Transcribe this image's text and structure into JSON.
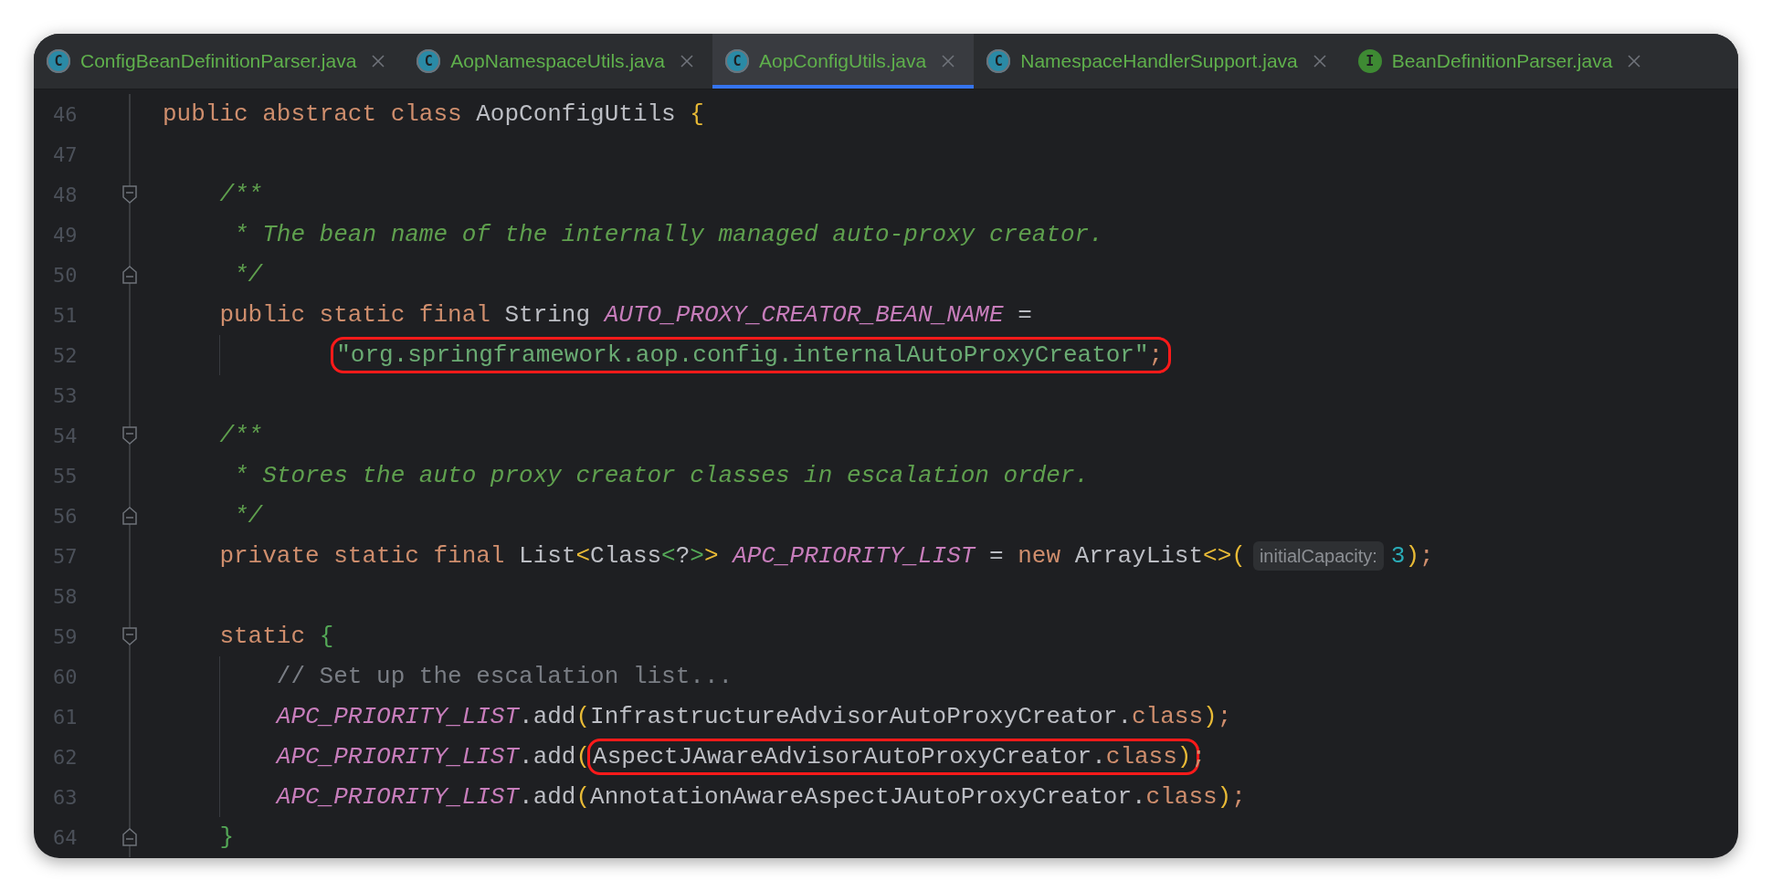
{
  "tabs": [
    {
      "label": "ConfigBeanDefinitionParser.java",
      "icon": {
        "kind": "class",
        "letter": "C"
      },
      "selected": false
    },
    {
      "label": "AopNamespaceUtils.java",
      "icon": {
        "kind": "class",
        "letter": "C"
      },
      "selected": false
    },
    {
      "label": "AopConfigUtils.java",
      "icon": {
        "kind": "class",
        "letter": "C"
      },
      "selected": true
    },
    {
      "label": "NamespaceHandlerSupport.java",
      "icon": {
        "kind": "class",
        "letter": "C"
      },
      "selected": false
    },
    {
      "label": "BeanDefinitionParser.java",
      "icon": {
        "kind": "interface",
        "letter": "I"
      },
      "selected": false
    }
  ],
  "editor": {
    "lines": [
      {
        "number": "46",
        "tokens": [
          {
            "kind": "keyword",
            "text": "public abstract class"
          },
          {
            "kind": "plain",
            "text": " AopConfigUtils "
          },
          {
            "kind": "bracket1",
            "text": "{"
          }
        ],
        "children": [
          {
            "number": "47"
          },
          {
            "number": "48",
            "fold_start": true,
            "tokens": [
              {
                "kind": "doc",
                "text": "/**"
              }
            ]
          },
          {
            "number": "49",
            "tokens": [
              {
                "kind": "doc",
                "text": " * The bean name of the internally managed auto-proxy creator."
              }
            ]
          },
          {
            "number": "50",
            "fold_end": true,
            "tokens": [
              {
                "kind": "doc",
                "text": " */"
              }
            ]
          },
          {
            "number": "51",
            "tokens": [
              {
                "kind": "keyword",
                "text": "public static final"
              },
              {
                "kind": "plain",
                "text": " String "
              },
              {
                "kind": "field",
                "text": "AUTO_PROXY_CREATOR_BEAN_NAME"
              },
              {
                "kind": "plain",
                "text": " ="
              }
            ],
            "children": [
              {
                "number": "52",
                "continuation": true,
                "tokens": [
                  {
                    "kind": "circled",
                    "tokens": [
                      {
                        "kind": "string",
                        "text": "\"org.springframework.aop.config.internalAutoProxyCreator\""
                      },
                      {
                        "kind": "keyword",
                        "text": ";"
                      }
                    ]
                  }
                ]
              }
            ]
          },
          {
            "number": "53"
          },
          {
            "number": "54",
            "fold_start": true,
            "tokens": [
              {
                "kind": "doc",
                "text": "/**"
              }
            ]
          },
          {
            "number": "55",
            "tokens": [
              {
                "kind": "doc",
                "text": " * Stores the auto proxy creator classes in escalation order."
              }
            ]
          },
          {
            "number": "56",
            "fold_end": true,
            "tokens": [
              {
                "kind": "doc",
                "text": " */"
              }
            ]
          },
          {
            "number": "57",
            "tokens": [
              {
                "kind": "keyword",
                "text": "private static final"
              },
              {
                "kind": "plain",
                "text": " List"
              },
              {
                "kind": "bracket1",
                "text": "<"
              },
              {
                "kind": "plain",
                "text": "Class"
              },
              {
                "kind": "bracket2",
                "text": "<"
              },
              {
                "kind": "plain",
                "text": "?"
              },
              {
                "kind": "bracket2",
                "text": ">"
              },
              {
                "kind": "bracket1",
                "text": ">"
              },
              {
                "kind": "field",
                "text": " APC_PRIORITY_LIST"
              },
              {
                "kind": "plain",
                "text": " = "
              },
              {
                "kind": "keyword",
                "text": "new"
              },
              {
                "kind": "plain",
                "text": " ArrayList"
              },
              {
                "kind": "bracket1",
                "text": "<>("
              },
              {
                "kind": "hint",
                "text": "initialCapacity:"
              },
              {
                "kind": "number",
                "text": "3"
              },
              {
                "kind": "bracket1",
                "text": ")"
              },
              {
                "kind": "keyword",
                "text": ";"
              }
            ]
          },
          {
            "number": "58"
          },
          {
            "number": "59",
            "fold_start": true,
            "tokens": [
              {
                "kind": "keyword",
                "text": "static"
              },
              {
                "kind": "bracket2",
                "text": " {"
              }
            ],
            "children": [
              {
                "number": "60",
                "tokens": [
                  {
                    "kind": "comment",
                    "text": "// Set up the escalation list..."
                  }
                ]
              },
              {
                "number": "61",
                "tokens": [
                  {
                    "kind": "field",
                    "text": "APC_PRIORITY_LIST"
                  },
                  {
                    "kind": "plain",
                    "text": ".add"
                  },
                  {
                    "kind": "bracket1",
                    "text": "("
                  },
                  {
                    "kind": "plain",
                    "text": "InfrastructureAdvisorAutoProxyCreator."
                  },
                  {
                    "kind": "keyword",
                    "text": "class"
                  },
                  {
                    "kind": "bracket1",
                    "text": ")"
                  },
                  {
                    "kind": "keyword",
                    "text": ";"
                  }
                ]
              },
              {
                "number": "62",
                "tokens": [
                  {
                    "kind": "field",
                    "text": "APC_PRIORITY_LIST"
                  },
                  {
                    "kind": "plain",
                    "text": ".add"
                  },
                  {
                    "kind": "bracket1",
                    "text": "("
                  },
                  {
                    "kind": "circled",
                    "tokens": [
                      {
                        "kind": "plain",
                        "text": "AspectJAwareAdvisorAutoProxyCreator."
                      },
                      {
                        "kind": "keyword",
                        "text": "class"
                      },
                      {
                        "kind": "bracket1",
                        "text": ")"
                      }
                    ]
                  },
                  {
                    "kind": "keyword",
                    "text": ";"
                  }
                ]
              },
              {
                "number": "63",
                "tokens": [
                  {
                    "kind": "field",
                    "text": "APC_PRIORITY_LIST"
                  },
                  {
                    "kind": "plain",
                    "text": ".add"
                  },
                  {
                    "kind": "bracket1",
                    "text": "("
                  },
                  {
                    "kind": "plain",
                    "text": "AnnotationAwareAspectJAutoProxyCreator."
                  },
                  {
                    "kind": "keyword",
                    "text": "class"
                  },
                  {
                    "kind": "bracket1",
                    "text": ")"
                  },
                  {
                    "kind": "keyword",
                    "text": ";"
                  }
                ]
              }
            ]
          },
          {
            "number": "64",
            "fold_end": true,
            "tokens": [
              {
                "kind": "bracket2",
                "text": "}"
              }
            ]
          }
        ]
      }
    ]
  }
}
